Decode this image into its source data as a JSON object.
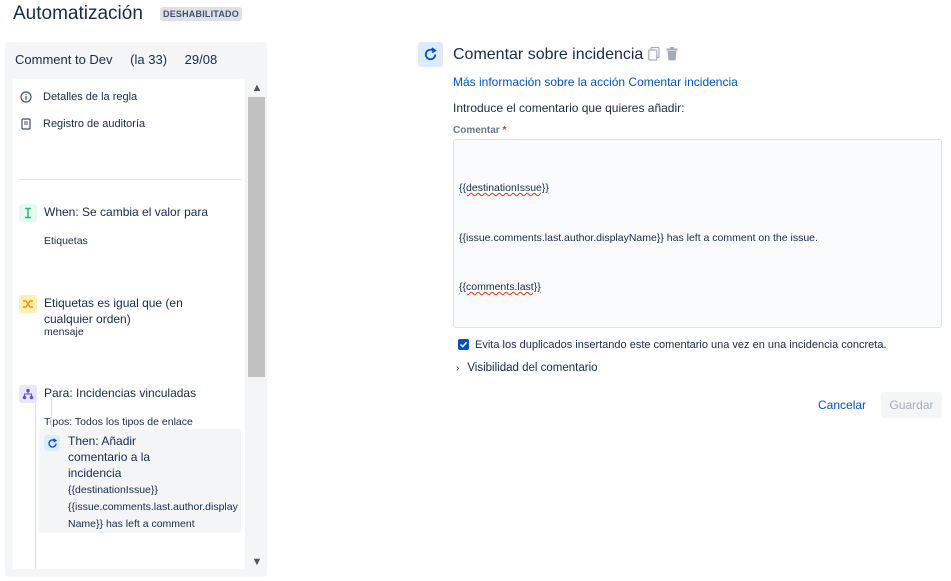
{
  "header": {
    "title": "Automatización",
    "status_badge": "DESHABILITADO"
  },
  "rule": {
    "name": "Comment to Dev",
    "version": "(la 33)",
    "date": "29/08",
    "meta_items": [
      {
        "label": "Detalles de la regla",
        "icon": "info-icon"
      },
      {
        "label": "Registro de auditoría",
        "icon": "document-icon"
      }
    ],
    "steps": [
      {
        "title": "When: Se cambia el valor para",
        "subtitle": "Etiquetas",
        "icon": "trigger-icon",
        "color": "#36b37e"
      },
      {
        "title": "Etiquetas es igual que (en cualquier orden)",
        "subtitle": "mensaje",
        "icon": "shuffle-icon",
        "color": "#ffc400"
      },
      {
        "title": "Para: Incidencias vinculadas",
        "subtitle": "Tipos: Todos los tipos de enlace",
        "icon": "branch-icon",
        "color": "#6554c0"
      }
    ],
    "action": {
      "title": "Then: Añadir comentario a la incidencia",
      "body": "{{destinationIssue}}\n{{issue.comments.last.author.displayName}} has left a comment",
      "icon": "refresh-comment-icon"
    }
  },
  "editor": {
    "title": "Comentar sobre incidencia",
    "more_link": "Más información sobre la acción Comentar incidencia",
    "instruction": "Introduce el comentario que quieres añadir:",
    "field_label": "Comentar",
    "required_mark": "*",
    "comment_lines": [
      "{{destinationIssue}}",
      "{{issue.comments.last.author.displayName}} has left a comment on the issue.",
      "{{comments.last}}"
    ],
    "checkbox_label": "Evita los duplicados insertando este comentario una vez en una incidencia concreta.",
    "checkbox_checked": true,
    "visibility_label": "Visibilidad del comentario",
    "cancel_label": "Cancelar",
    "save_label": "Guardar"
  },
  "colors": {
    "accent": "#0052cc",
    "danger": "#de350b"
  }
}
